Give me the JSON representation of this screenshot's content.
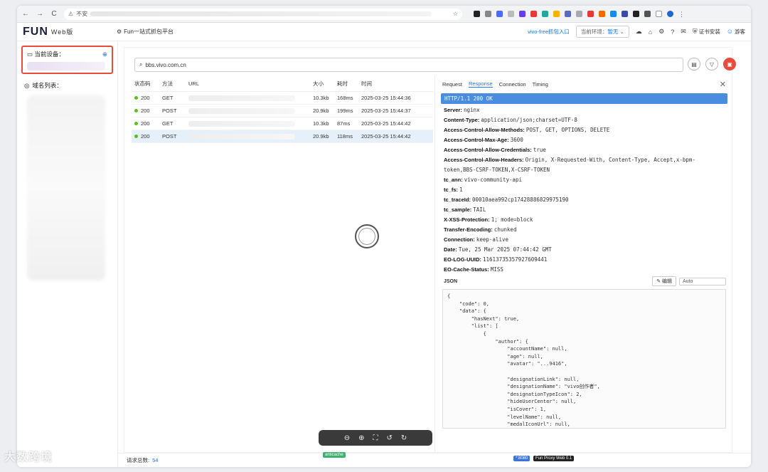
{
  "browser": {
    "security_label": "不安",
    "nav": [
      "←",
      "→",
      "C"
    ]
  },
  "app": {
    "logo": "FUN",
    "logo_sub": "Web版",
    "platform_title": "Fun一站式抓包平台",
    "capture_link": "vivo-free抓包入口",
    "env_label": "当前环境：",
    "env_value": "暂无",
    "cert_install": "证书安装",
    "user": "游客"
  },
  "sidebar": {
    "current_device": "当前设备：",
    "domain_list": "域名列表："
  },
  "search": {
    "value": "bbs.vivo.com.cn"
  },
  "table": {
    "headers": [
      "状态码",
      "方法",
      "URL",
      "大小",
      "耗时",
      "时间"
    ],
    "rows": [
      {
        "status": "200",
        "method": "GET",
        "size": "10.3kb",
        "time": "168ms",
        "date": "2025-03-25 15:44:36"
      },
      {
        "status": "200",
        "method": "POST",
        "size": "20.9kb",
        "time": "199ms",
        "date": "2025-03-25 15:44:37"
      },
      {
        "status": "200",
        "method": "GET",
        "size": "10.3kb",
        "time": "87ms",
        "date": "2025-03-25 15:44:42"
      },
      {
        "status": "200",
        "method": "POST",
        "size": "20.9kb",
        "time": "118ms",
        "date": "2025-03-25 15:44:42"
      }
    ]
  },
  "detail": {
    "tabs": [
      "Request",
      "Response",
      "Connection",
      "Timing"
    ],
    "active_tab": "Response",
    "status_line": "HTTP/1.1 200 OK",
    "headers": [
      {
        "k": "Server",
        "v": "nginx"
      },
      {
        "k": "Content-Type",
        "v": "application/json;charset=UTF-8"
      },
      {
        "k": "Access-Control-Allow-Methods",
        "v": "POST, GET, OPTIONS, DELETE"
      },
      {
        "k": "Access-Control-Max-Age",
        "v": "3600"
      },
      {
        "k": "Access-Control-Allow-Credentials",
        "v": "true"
      },
      {
        "k": "Access-Control-Allow-Headers",
        "v": "Origin, X-Requested-With, Content-Type, Accept,x-bpm-token,BBS-CSRF-TOKEN,X-CSRF-TOKEN"
      },
      {
        "k": "tc_ann",
        "v": "vivo-community-api"
      },
      {
        "k": "tc_fs",
        "v": "1"
      },
      {
        "k": "tc_traceId",
        "v": "00010aea992cp17428886829975190"
      },
      {
        "k": "tc_sample",
        "v": "TAIL"
      },
      {
        "k": "X-XSS-Protection",
        "v": "1; mode=block"
      },
      {
        "k": "Transfer-Encoding",
        "v": "chunked"
      },
      {
        "k": "Connection",
        "v": "keep-alive"
      },
      {
        "k": "Date",
        "v": "Tue, 25 Mar 2025 07:44:42 GMT"
      },
      {
        "k": "EO-LOG-UUID",
        "v": "11613735357927609441"
      },
      {
        "k": "EO-Cache-Status",
        "v": "MISS"
      }
    ],
    "json_label": "JSON",
    "edit_label": "编辑",
    "format_value": "Auto",
    "json_lines": [
      "{",
      "    \"code\": 0,",
      "    \"data\": {",
      "        \"hasNext\": true,",
      "        \"list\": [",
      "            {",
      "                \"author\": {",
      "                    \"accountName\": null,",
      "                    \"age\": null,",
      "                    \"avatar\": \"...9416\",",
      "                    ",
      "                    \"designationLink\": null,",
      "                    \"designationName\": \"vivo创作者\",",
      "                    \"designationTypeIcon\": 2,",
      "                    \"hideUserCenter\": null,",
      "                    \"isCover\": 1,",
      "                    \"levelName\": null,",
      "                    \"medalIconUrl\": null,",
      "                    \"medalName\": null,"
    ]
  },
  "footer": {
    "total_label": "请求总数:",
    "total_value": "54",
    "badge_anticache": "anticache",
    "badge_port": "*:8080",
    "badge_version": "Fun Proxy Web 0.1"
  },
  "watermark": "大数跨境"
}
